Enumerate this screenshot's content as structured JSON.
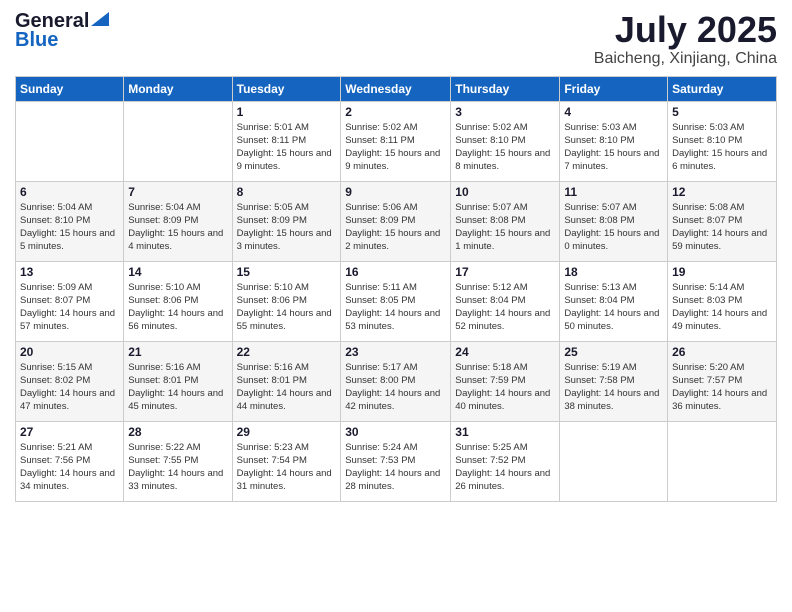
{
  "header": {
    "logo_line1": "General",
    "logo_line2": "Blue",
    "title": "July 2025",
    "subtitle": "Baicheng, Xinjiang, China"
  },
  "calendar": {
    "days_of_week": [
      "Sunday",
      "Monday",
      "Tuesday",
      "Wednesday",
      "Thursday",
      "Friday",
      "Saturday"
    ],
    "weeks": [
      [
        {
          "day": "",
          "detail": ""
        },
        {
          "day": "",
          "detail": ""
        },
        {
          "day": "1",
          "detail": "Sunrise: 5:01 AM\nSunset: 8:11 PM\nDaylight: 15 hours\nand 9 minutes."
        },
        {
          "day": "2",
          "detail": "Sunrise: 5:02 AM\nSunset: 8:11 PM\nDaylight: 15 hours\nand 9 minutes."
        },
        {
          "day": "3",
          "detail": "Sunrise: 5:02 AM\nSunset: 8:10 PM\nDaylight: 15 hours\nand 8 minutes."
        },
        {
          "day": "4",
          "detail": "Sunrise: 5:03 AM\nSunset: 8:10 PM\nDaylight: 15 hours\nand 7 minutes."
        },
        {
          "day": "5",
          "detail": "Sunrise: 5:03 AM\nSunset: 8:10 PM\nDaylight: 15 hours\nand 6 minutes."
        }
      ],
      [
        {
          "day": "6",
          "detail": "Sunrise: 5:04 AM\nSunset: 8:10 PM\nDaylight: 15 hours\nand 5 minutes."
        },
        {
          "day": "7",
          "detail": "Sunrise: 5:04 AM\nSunset: 8:09 PM\nDaylight: 15 hours\nand 4 minutes."
        },
        {
          "day": "8",
          "detail": "Sunrise: 5:05 AM\nSunset: 8:09 PM\nDaylight: 15 hours\nand 3 minutes."
        },
        {
          "day": "9",
          "detail": "Sunrise: 5:06 AM\nSunset: 8:09 PM\nDaylight: 15 hours\nand 2 minutes."
        },
        {
          "day": "10",
          "detail": "Sunrise: 5:07 AM\nSunset: 8:08 PM\nDaylight: 15 hours\nand 1 minute."
        },
        {
          "day": "11",
          "detail": "Sunrise: 5:07 AM\nSunset: 8:08 PM\nDaylight: 15 hours\nand 0 minutes."
        },
        {
          "day": "12",
          "detail": "Sunrise: 5:08 AM\nSunset: 8:07 PM\nDaylight: 14 hours\nand 59 minutes."
        }
      ],
      [
        {
          "day": "13",
          "detail": "Sunrise: 5:09 AM\nSunset: 8:07 PM\nDaylight: 14 hours\nand 57 minutes."
        },
        {
          "day": "14",
          "detail": "Sunrise: 5:10 AM\nSunset: 8:06 PM\nDaylight: 14 hours\nand 56 minutes."
        },
        {
          "day": "15",
          "detail": "Sunrise: 5:10 AM\nSunset: 8:06 PM\nDaylight: 14 hours\nand 55 minutes."
        },
        {
          "day": "16",
          "detail": "Sunrise: 5:11 AM\nSunset: 8:05 PM\nDaylight: 14 hours\nand 53 minutes."
        },
        {
          "day": "17",
          "detail": "Sunrise: 5:12 AM\nSunset: 8:04 PM\nDaylight: 14 hours\nand 52 minutes."
        },
        {
          "day": "18",
          "detail": "Sunrise: 5:13 AM\nSunset: 8:04 PM\nDaylight: 14 hours\nand 50 minutes."
        },
        {
          "day": "19",
          "detail": "Sunrise: 5:14 AM\nSunset: 8:03 PM\nDaylight: 14 hours\nand 49 minutes."
        }
      ],
      [
        {
          "day": "20",
          "detail": "Sunrise: 5:15 AM\nSunset: 8:02 PM\nDaylight: 14 hours\nand 47 minutes."
        },
        {
          "day": "21",
          "detail": "Sunrise: 5:16 AM\nSunset: 8:01 PM\nDaylight: 14 hours\nand 45 minutes."
        },
        {
          "day": "22",
          "detail": "Sunrise: 5:16 AM\nSunset: 8:01 PM\nDaylight: 14 hours\nand 44 minutes."
        },
        {
          "day": "23",
          "detail": "Sunrise: 5:17 AM\nSunset: 8:00 PM\nDaylight: 14 hours\nand 42 minutes."
        },
        {
          "day": "24",
          "detail": "Sunrise: 5:18 AM\nSunset: 7:59 PM\nDaylight: 14 hours\nand 40 minutes."
        },
        {
          "day": "25",
          "detail": "Sunrise: 5:19 AM\nSunset: 7:58 PM\nDaylight: 14 hours\nand 38 minutes."
        },
        {
          "day": "26",
          "detail": "Sunrise: 5:20 AM\nSunset: 7:57 PM\nDaylight: 14 hours\nand 36 minutes."
        }
      ],
      [
        {
          "day": "27",
          "detail": "Sunrise: 5:21 AM\nSunset: 7:56 PM\nDaylight: 14 hours\nand 34 minutes."
        },
        {
          "day": "28",
          "detail": "Sunrise: 5:22 AM\nSunset: 7:55 PM\nDaylight: 14 hours\nand 33 minutes."
        },
        {
          "day": "29",
          "detail": "Sunrise: 5:23 AM\nSunset: 7:54 PM\nDaylight: 14 hours\nand 31 minutes."
        },
        {
          "day": "30",
          "detail": "Sunrise: 5:24 AM\nSunset: 7:53 PM\nDaylight: 14 hours\nand 28 minutes."
        },
        {
          "day": "31",
          "detail": "Sunrise: 5:25 AM\nSunset: 7:52 PM\nDaylight: 14 hours\nand 26 minutes."
        },
        {
          "day": "",
          "detail": ""
        },
        {
          "day": "",
          "detail": ""
        }
      ]
    ]
  }
}
